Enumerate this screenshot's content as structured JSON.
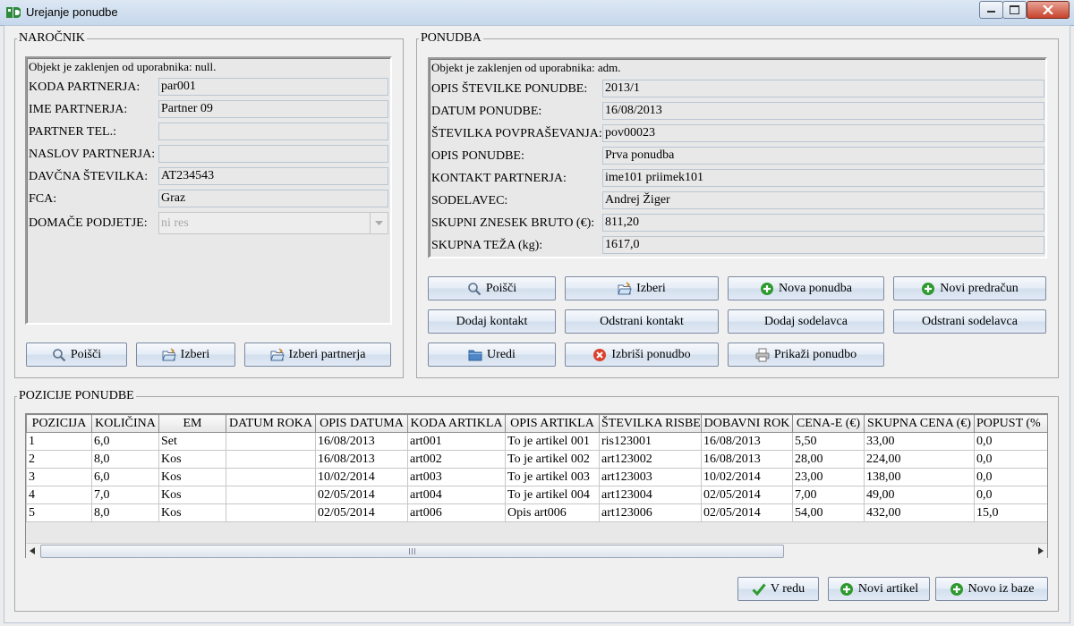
{
  "window": {
    "title": "Urejanje ponudbe"
  },
  "narocnik": {
    "legend": "NAROČNIK",
    "lock_text": "Objekt je zaklenjen od uporabnika: null.",
    "fields": [
      {
        "label": "KODA PARTNERJA:",
        "value": "par001"
      },
      {
        "label": "IME PARTNERJA:",
        "value": "Partner 09"
      },
      {
        "label": "PARTNER TEL.:",
        "value": ""
      },
      {
        "label": "NASLOV PARTNERJA:",
        "value": ""
      },
      {
        "label": "DAVČNA ŠTEVILKA:",
        "value": "AT234543"
      },
      {
        "label": "FCA:",
        "value": "Graz"
      }
    ],
    "domace": {
      "label": "DOMAČE PODJETJE:",
      "value": "ni res"
    },
    "buttons": {
      "poisci": "Poišči",
      "izberi": "Izberi",
      "izberi_partnerja": "Izberi partnerja"
    }
  },
  "ponudba": {
    "legend": "PONUDBA",
    "lock_text": "Objekt je zaklenjen od uporabnika: adm.",
    "fields": [
      {
        "label": "OPIS ŠTEVILKE PONUDBE:",
        "value": "2013/1"
      },
      {
        "label": "DATUM PONUDBE:",
        "value": "16/08/2013"
      },
      {
        "label": "ŠTEVILKA POVPRAŠEVANJA:",
        "value": "pov00023"
      },
      {
        "label": "OPIS PONUDBE:",
        "value": "Prva ponudba"
      },
      {
        "label": "KONTAKT PARTNERJA:",
        "value": "ime101 priimek101"
      },
      {
        "label": "SODELAVEC:",
        "value": "Andrej Žiger"
      },
      {
        "label": "SKUPNI ZNESEK BRUTO (€):",
        "value": "811,20"
      },
      {
        "label": "SKUPNA TEŽA (kg):",
        "value": "1617,0"
      }
    ],
    "buttons": {
      "poisci": "Poišči",
      "izberi": "Izberi",
      "nova_ponudba": "Nova ponudba",
      "novi_predracun": "Novi predračun",
      "dodaj_kontakt": "Dodaj kontakt",
      "odstrani_kontakt": "Odstrani kontakt",
      "dodaj_sodelavca": "Dodaj sodelavca",
      "odstrani_sodelavca": "Odstrani sodelavca",
      "uredi": "Uredi",
      "izbrisi_ponudbo": "Izbriši ponudbo",
      "prikazi_ponudbo": "Prikaži ponudbo"
    }
  },
  "pozicije": {
    "legend": "POZICIJE PONUDBE",
    "columns": [
      "POZICIJA",
      "KOLIČINA",
      "EM",
      "DATUM ROKA",
      "OPIS DATUMA",
      "KODA ARTIKLA",
      "OPIS ARTIKLA",
      "ŠTEVILKA RISBE",
      "DOBAVNI ROK",
      "CENA-E (€)",
      "SKUPNA CENA (€)",
      "POPUST (%"
    ],
    "rows": [
      [
        "1",
        "6,0",
        "Set",
        "",
        "16/08/2013",
        "art001",
        "To je artikel 001",
        "ris123001",
        "16/08/2013",
        "5,50",
        "33,00",
        "0,0"
      ],
      [
        "2",
        "8,0",
        "Kos",
        "",
        "16/08/2013",
        "art002",
        "To je artikel 002",
        "art123002",
        "16/08/2013",
        "28,00",
        "224,00",
        "0,0"
      ],
      [
        "3",
        "6,0",
        "Kos",
        "",
        "10/02/2014",
        "art003",
        "To je artikel 003",
        "art123003",
        "10/02/2014",
        "23,00",
        "138,00",
        "0,0"
      ],
      [
        "4",
        "7,0",
        "Kos",
        "",
        "02/05/2014",
        "art004",
        "To je artikel 004",
        "art123004",
        "02/05/2014",
        "7,00",
        "49,00",
        "0,0"
      ],
      [
        "5",
        "8,0",
        "Kos",
        "",
        "02/05/2014",
        "art006",
        "Opis art006",
        "art123006",
        "02/05/2014",
        "54,00",
        "432,00",
        "15,0"
      ]
    ],
    "buttons": {
      "v_redu": "V redu",
      "novi_artikel": "Novi artikel",
      "novo_iz_baze": "Novo iz baze"
    }
  },
  "colors": {
    "accent_green": "#2e9a2e",
    "delete_red": "#d9412c",
    "folder_blue": "#4f86c6"
  },
  "icons": [
    "search-icon",
    "folder-open-icon",
    "add-icon",
    "folder-icon",
    "delete-icon",
    "printer-icon",
    "check-icon"
  ]
}
